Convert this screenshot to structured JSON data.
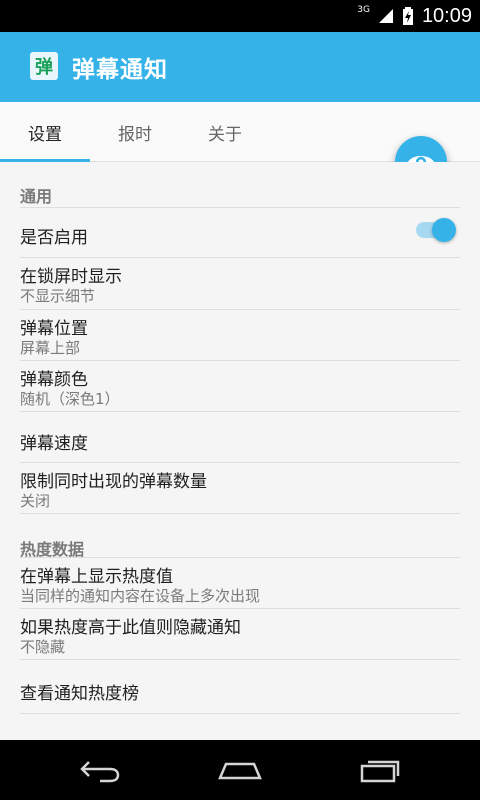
{
  "status_bar": {
    "network": "3G",
    "time": "10:09"
  },
  "app_bar": {
    "icon_text": "弹",
    "title": "弹幕通知"
  },
  "tabs": [
    {
      "label": "设置",
      "active": true
    },
    {
      "label": "报时",
      "active": false
    },
    {
      "label": "关于",
      "active": false
    }
  ],
  "fab": {
    "icon": "eye-icon"
  },
  "settings": {
    "general_header": "通用",
    "enabled": {
      "title": "是否启用",
      "value": true
    },
    "lockscreen": {
      "title": "在锁屏时显示",
      "subtitle": "不显示细节"
    },
    "position": {
      "title": "弹幕位置",
      "subtitle": "屏幕上部"
    },
    "color": {
      "title": "弹幕颜色",
      "subtitle": "随机（深色1）"
    },
    "speed": {
      "title": "弹幕速度"
    },
    "limit": {
      "title": "限制同时出现的弹幕数量",
      "subtitle": "关闭"
    },
    "heat_header": "热度数据",
    "show_heat": {
      "title": "在弹幕上显示热度值",
      "subtitle": "当同样的通知内容在设备上多次出现"
    },
    "hide_heat": {
      "title": "如果热度高于此值则隐藏通知",
      "subtitle": "不隐藏"
    },
    "ranking": {
      "title": "查看通知热度榜"
    }
  },
  "colors": {
    "accent": "#35b3e8",
    "status_bar": "#000000",
    "background": "#f5f5f5"
  },
  "nav": {
    "back": "back-icon",
    "home": "home-icon",
    "recents": "recents-icon"
  }
}
